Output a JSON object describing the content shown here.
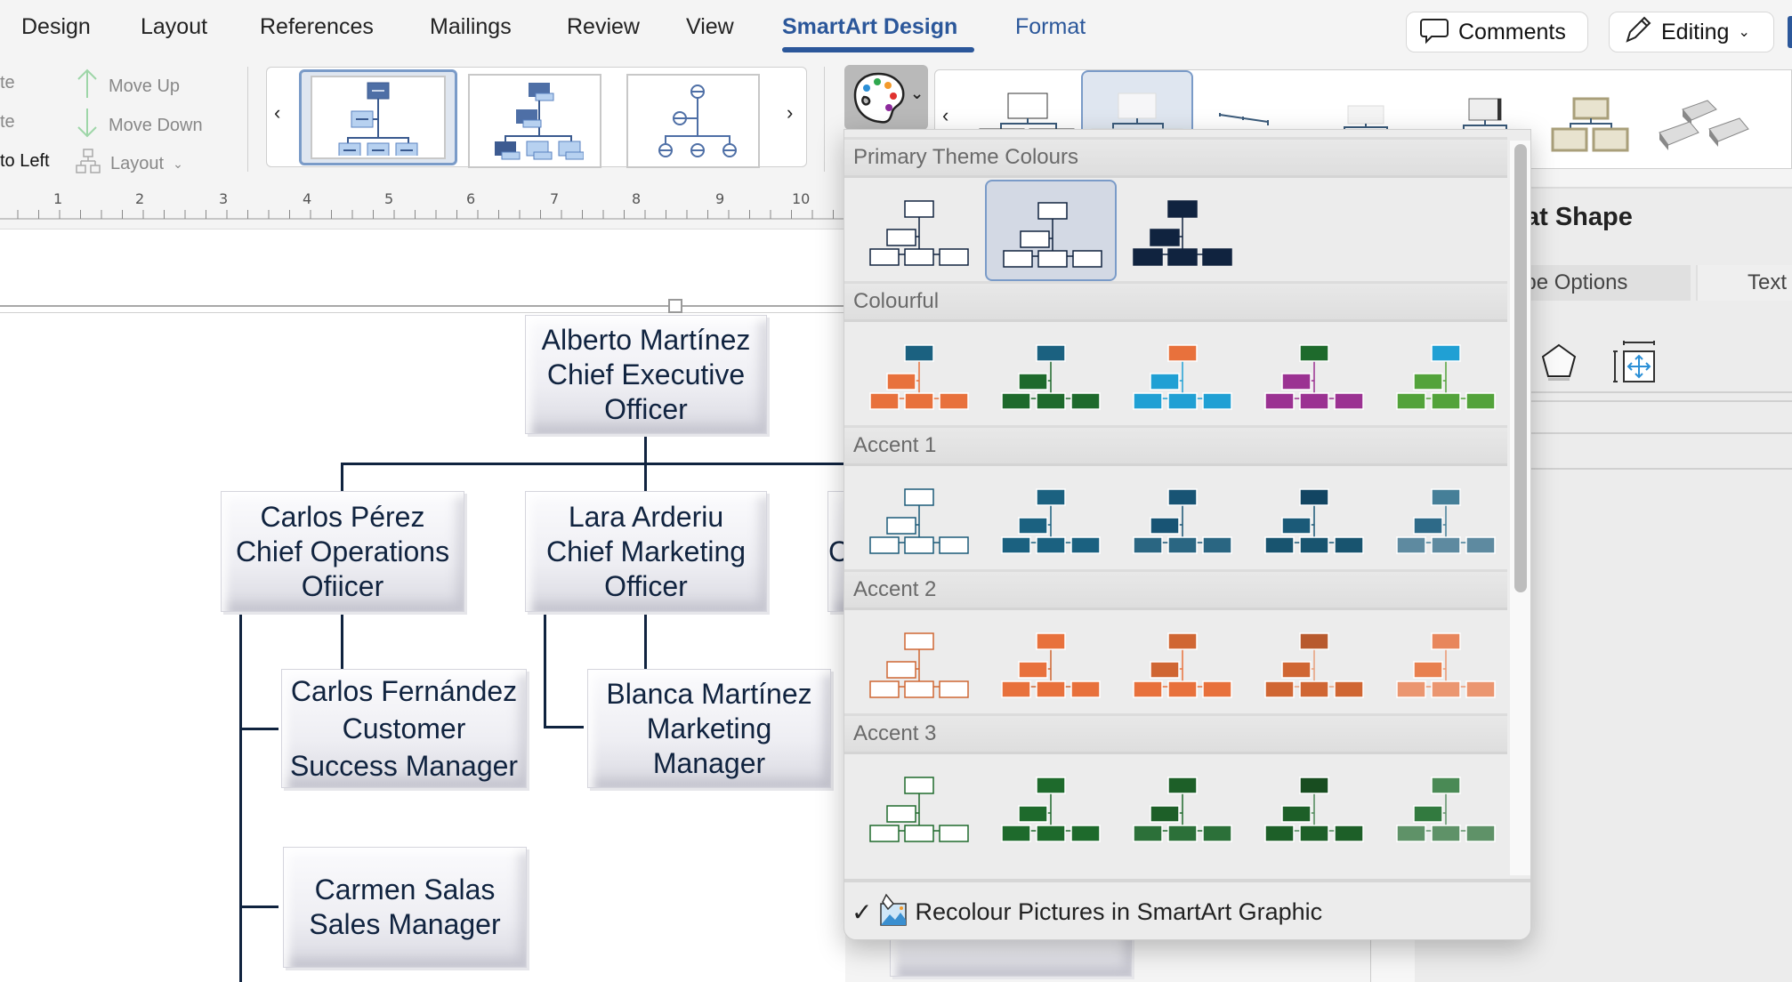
{
  "tabs": [
    {
      "label": "Design",
      "active": false
    },
    {
      "label": "Layout",
      "active": false
    },
    {
      "label": "References",
      "active": false
    },
    {
      "label": "Mailings",
      "active": false
    },
    {
      "label": "Review",
      "active": false
    },
    {
      "label": "View",
      "active": false
    },
    {
      "label": "SmartArt Design",
      "active": true
    },
    {
      "label": "Format",
      "active": false
    }
  ],
  "header_buttons": {
    "comments": "Comments",
    "editing": "Editing"
  },
  "ribbon": {
    "left_partial": [
      "te",
      "te",
      "to Left"
    ],
    "move_up": "Move Up",
    "move_down": "Move Down",
    "layout": "Layout",
    "icons": {
      "move_up": "arrow-up-icon",
      "move_down": "arrow-down-icon",
      "layout": "org-chart-icon",
      "change_colours": "palette-icon"
    }
  },
  "ruler": {
    "numbers": [
      "1",
      "2",
      "3",
      "4",
      "5",
      "6",
      "7",
      "8",
      "9",
      "10"
    ]
  },
  "org_chart": {
    "nodes": [
      {
        "id": "ceo",
        "text": "Alberto Martínez\nChief Executive\nOfficer"
      },
      {
        "id": "coo",
        "text": "Carlos Pérez\nChief  Operations\nOfiicer"
      },
      {
        "id": "cmo",
        "text": "Lara Arderiu\nChief Marketing\nOfficer"
      },
      {
        "id": "third",
        "text": "C"
      },
      {
        "id": "csm",
        "text": "Carlos Fernández\nCustomer\nSuccess Manager"
      },
      {
        "id": "mm",
        "text": "Blanca Martínez\nMarketing\nManager"
      },
      {
        "id": "sm",
        "text": "Carmen Salas\nSales Manager"
      }
    ],
    "text_color": "#10233f"
  },
  "task_pane": {
    "title": "at Shape",
    "tabs": [
      "ape Options",
      "Text"
    ],
    "icons": [
      "pentagon-fill-icon",
      "size-properties-icon"
    ]
  },
  "colour_dropdown": {
    "sections": [
      {
        "title": "Primary Theme Colours",
        "swatches": [
          {
            "fill": "#ffffff",
            "top": "#ffffff",
            "mid": "#ffffff",
            "line": "#10233f",
            "outline": "#10233f"
          },
          {
            "fill": "#ffffff",
            "top": "#ffffff",
            "mid": "#ffffff",
            "line": "#10233f",
            "outline": "#10233f",
            "selected": true
          },
          {
            "fill": "#10233f",
            "top": "#10233f",
            "mid": "#10233f",
            "line": "#10233f",
            "outline": "#10233f"
          }
        ]
      },
      {
        "title": "Colourful",
        "swatches": [
          {
            "fill": "#e8713c",
            "top": "#1b6180",
            "mid": "#e8713c",
            "line": "#e8713c",
            "outline": "#ffffff"
          },
          {
            "fill": "#1e6a2c",
            "top": "#1b6180",
            "mid": "#1e6a2c",
            "line": "#1e6a2c",
            "outline": "#ffffff"
          },
          {
            "fill": "#20a0d4",
            "top": "#e8713c",
            "mid": "#20a0d4",
            "line": "#20a0d4",
            "outline": "#ffffff"
          },
          {
            "fill": "#9b3292",
            "top": "#1e6a2c",
            "mid": "#9b3292",
            "line": "#9b3292",
            "outline": "#ffffff"
          },
          {
            "fill": "#53a33b",
            "top": "#20a0d4",
            "mid": "#53a33b",
            "line": "#53a33b",
            "outline": "#ffffff"
          }
        ]
      },
      {
        "title": "Accent 1",
        "swatches": [
          {
            "fill": "#ffffff",
            "top": "#ffffff",
            "mid": "#ffffff",
            "line": "#1b5a78",
            "outline": "#1b5a78"
          },
          {
            "fill": "#1b6180",
            "top": "#1b6180",
            "mid": "#1b6180",
            "line": "#1b6180",
            "outline": "#ffffff"
          },
          {
            "fill": "#2a6682",
            "top": "#185474",
            "mid": "#185474",
            "line": "#185474",
            "outline": "#ffffff"
          },
          {
            "fill": "#18546f",
            "top": "#124562",
            "mid": "#1b5a78",
            "line": "#1b5a78",
            "outline": "#ffffff"
          },
          {
            "fill": "#5e8aa0",
            "top": "#457f98",
            "mid": "#2e6a88",
            "line": "#457f98",
            "outline": "#ffffff"
          }
        ]
      },
      {
        "title": "Accent 2",
        "swatches": [
          {
            "fill": "#ffffff",
            "top": "#ffffff",
            "mid": "#ffffff",
            "line": "#cf6633",
            "outline": "#cf6633"
          },
          {
            "fill": "#e8713c",
            "top": "#e8713c",
            "mid": "#e8713c",
            "line": "#cf6633",
            "outline": "#ffffff"
          },
          {
            "fill": "#e8713c",
            "top": "#d06633",
            "mid": "#d06633",
            "line": "#e8713c",
            "outline": "#ffffff"
          },
          {
            "fill": "#d06633",
            "top": "#b85a2e",
            "mid": "#d06633",
            "line": "#e8a07c",
            "outline": "#ffffff"
          },
          {
            "fill": "#eb9670",
            "top": "#e8865c",
            "mid": "#e8804f",
            "line": "#eb9670",
            "outline": "#ffffff"
          }
        ]
      },
      {
        "title": "Accent 3",
        "swatches": [
          {
            "fill": "#ffffff",
            "top": "#ffffff",
            "mid": "#ffffff",
            "line": "#1e6a2c",
            "outline": "#1e6a2c"
          },
          {
            "fill": "#1e6a2c",
            "top": "#1e6a2c",
            "mid": "#1e6a2c",
            "line": "#1e6a2c",
            "outline": "#ffffff"
          },
          {
            "fill": "#2c7039",
            "top": "#1d5f28",
            "mid": "#1d5f28",
            "line": "#1e6a2c",
            "outline": "#ffffff"
          },
          {
            "fill": "#1d5f28",
            "top": "#184d20",
            "mid": "#1d5f28",
            "line": "#4f8a5a",
            "outline": "#ffffff"
          },
          {
            "fill": "#5f9268",
            "top": "#4a8a55",
            "mid": "#327a3f",
            "line": "#5f9268",
            "outline": "#ffffff"
          }
        ]
      }
    ],
    "footer": {
      "checked": true,
      "label": "Recolour Pictures in SmartArt Graphic",
      "icon": "recolour-picture-icon"
    }
  }
}
